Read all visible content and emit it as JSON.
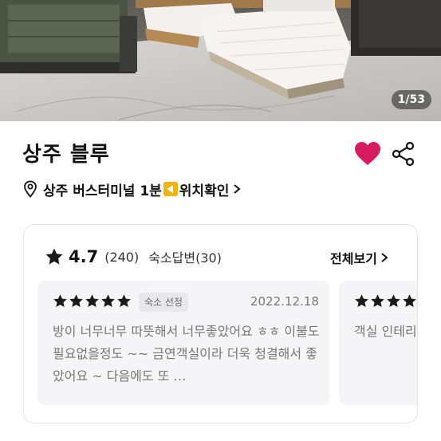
{
  "hero": {
    "image_description": "",
    "counter": "1/53"
  },
  "property": {
    "name": "상주 블루",
    "favorite_color": "#d81b60"
  },
  "location": {
    "text": "상주 버스터미널 1분",
    "link_label": "위치확인"
  },
  "reviews": {
    "rating": "4.7",
    "count": "(240)",
    "host_reply": "숙소답변(30)",
    "see_all_label": "전체보기",
    "items": [
      {
        "badge": "숙소 선정",
        "date": "2022.12.18",
        "text": "방이 너무너무 따뜻해서 너무좋았어요 ㅎㅎ 이불도 필요없을정도 ~~ 금연객실이라 더욱 청결해서 좋았어요 ~ 다음에도 또 …"
      },
      {
        "badge": "",
        "date": "",
        "text": "객실 인테리어요.🥰사 부담스러웠"
      }
    ]
  },
  "colors": {
    "star": "#1a1a1a",
    "heart": "#d81b60",
    "pin_flag": "#f4b400"
  }
}
